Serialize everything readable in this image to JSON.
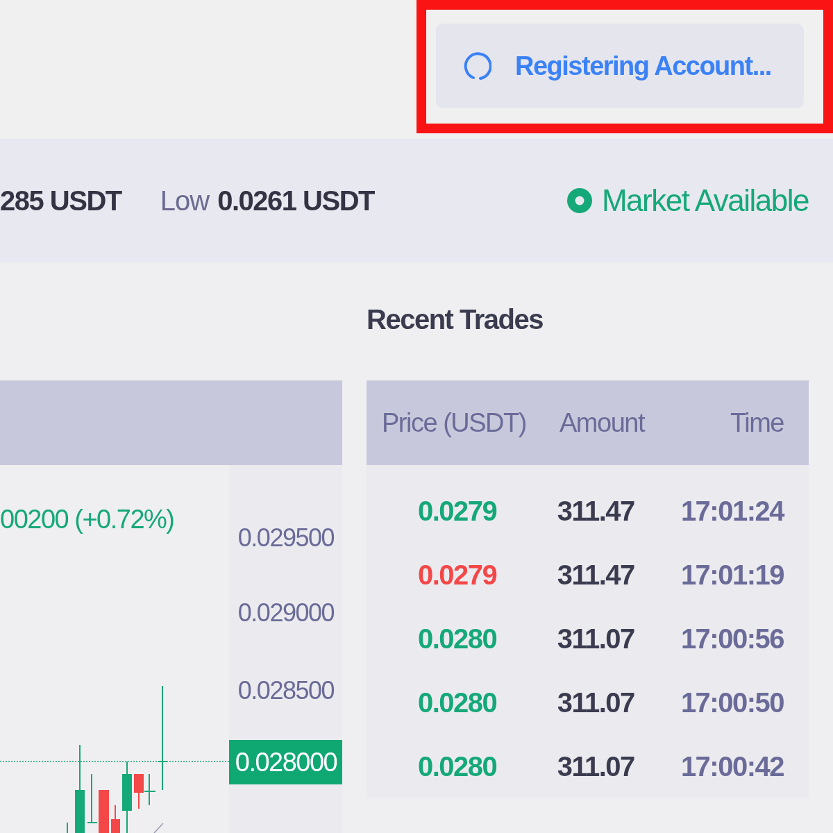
{
  "status_button": {
    "label": "Registering Account...",
    "loading": true,
    "highlighted": true
  },
  "stats": [
    {
      "value": "285 USDT"
    },
    {
      "label": "Low",
      "value": "0.0261 USDT"
    }
  ],
  "market_status": {
    "label": "Market Available",
    "available": true
  },
  "chart": {
    "change": "00200 (+0.72%)",
    "price_labels": [
      "0.029500",
      "0.029000",
      "0.028500"
    ],
    "current_price": "0.028000"
  },
  "recent_trades": {
    "title": "Recent Trades",
    "columns": [
      "Price (USDT)",
      "Amount",
      "Time"
    ],
    "rows": [
      {
        "price": "0.0279",
        "amount": "311.47",
        "time": "17:01:24",
        "color": "#15a878"
      },
      {
        "price": "0.0279",
        "amount": "311.47",
        "time": "17:01:19",
        "color": "#f44747"
      },
      {
        "price": "0.0280",
        "amount": "311.07",
        "time": "17:00:56",
        "color": "#15a878"
      },
      {
        "price": "0.0280",
        "amount": "311.07",
        "time": "17:00:50",
        "color": "#15a878"
      },
      {
        "price": "0.0280",
        "amount": "311.07",
        "time": "17:00:42",
        "color": "#15a878"
      }
    ]
  }
}
